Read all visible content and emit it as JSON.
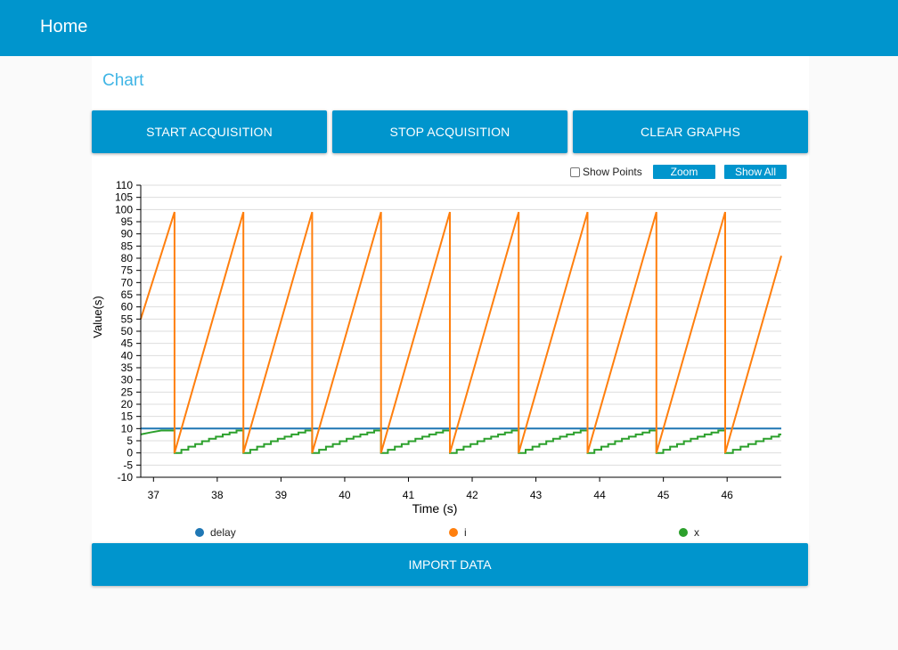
{
  "header": {
    "title": "Home"
  },
  "card": {
    "title": "Chart"
  },
  "buttons": {
    "start": "START ACQUISITION",
    "stop": "STOP ACQUISITION",
    "clear": "CLEAR GRAPHS",
    "import": "IMPORT DATA"
  },
  "chart_tools": {
    "show_points_label": "Show Points",
    "show_points_checked": false,
    "zoom_label": "Zoom",
    "show_all_label": "Show All"
  },
  "colors": {
    "brand": "#0095cd",
    "delay": "#1f77b4",
    "i": "#ff7f0e",
    "x": "#2ca02c"
  },
  "chart_data": {
    "type": "line",
    "xlabel": "Time (s)",
    "ylabel": "Value(s)",
    "xlim": [
      36.8,
      46.85
    ],
    "ylim": [
      -10,
      110
    ],
    "xticks": [
      37,
      38,
      39,
      40,
      41,
      42,
      43,
      44,
      45,
      46
    ],
    "yticks": [
      -10,
      -5,
      0,
      5,
      10,
      15,
      20,
      25,
      30,
      35,
      40,
      45,
      50,
      55,
      60,
      65,
      70,
      75,
      80,
      85,
      90,
      95,
      100,
      105,
      110
    ],
    "grid": true,
    "legend_position": "bottom",
    "resets": [
      37.33,
      38.41,
      39.49,
      40.57,
      41.65,
      42.73,
      43.81,
      44.89,
      45.97
    ],
    "series": [
      {
        "name": "delay",
        "color": "#1f77b4",
        "x": [
          36.8,
          46.85
        ],
        "y": [
          10,
          10
        ]
      },
      {
        "name": "i",
        "color": "#ff7f0e",
        "x": [
          36.8,
          37.33,
          37.33,
          38.41,
          38.41,
          39.49,
          39.49,
          40.57,
          40.57,
          41.65,
          41.65,
          42.73,
          42.73,
          43.81,
          43.81,
          44.89,
          44.89,
          45.97,
          45.97,
          46.85
        ],
        "y": [
          55,
          99,
          0,
          99,
          0,
          99,
          0,
          99,
          0,
          99,
          0,
          99,
          0,
          99,
          0,
          99,
          0,
          99,
          0,
          81
        ]
      },
      {
        "name": "x",
        "color": "#2ca02c",
        "steps": [
          0,
          1.3,
          2.6,
          3.6,
          4.8,
          5.8,
          6.7,
          7.6,
          8.4,
          9.2,
          9.2
        ],
        "first_segment": {
          "x": [
            36.8,
            36.95,
            37.12,
            37.33
          ],
          "y": [
            7.6,
            8.4,
            9.2,
            9.2
          ]
        },
        "last_segment_end": {
          "x": 46.85,
          "y": 8.4
        }
      }
    ]
  }
}
